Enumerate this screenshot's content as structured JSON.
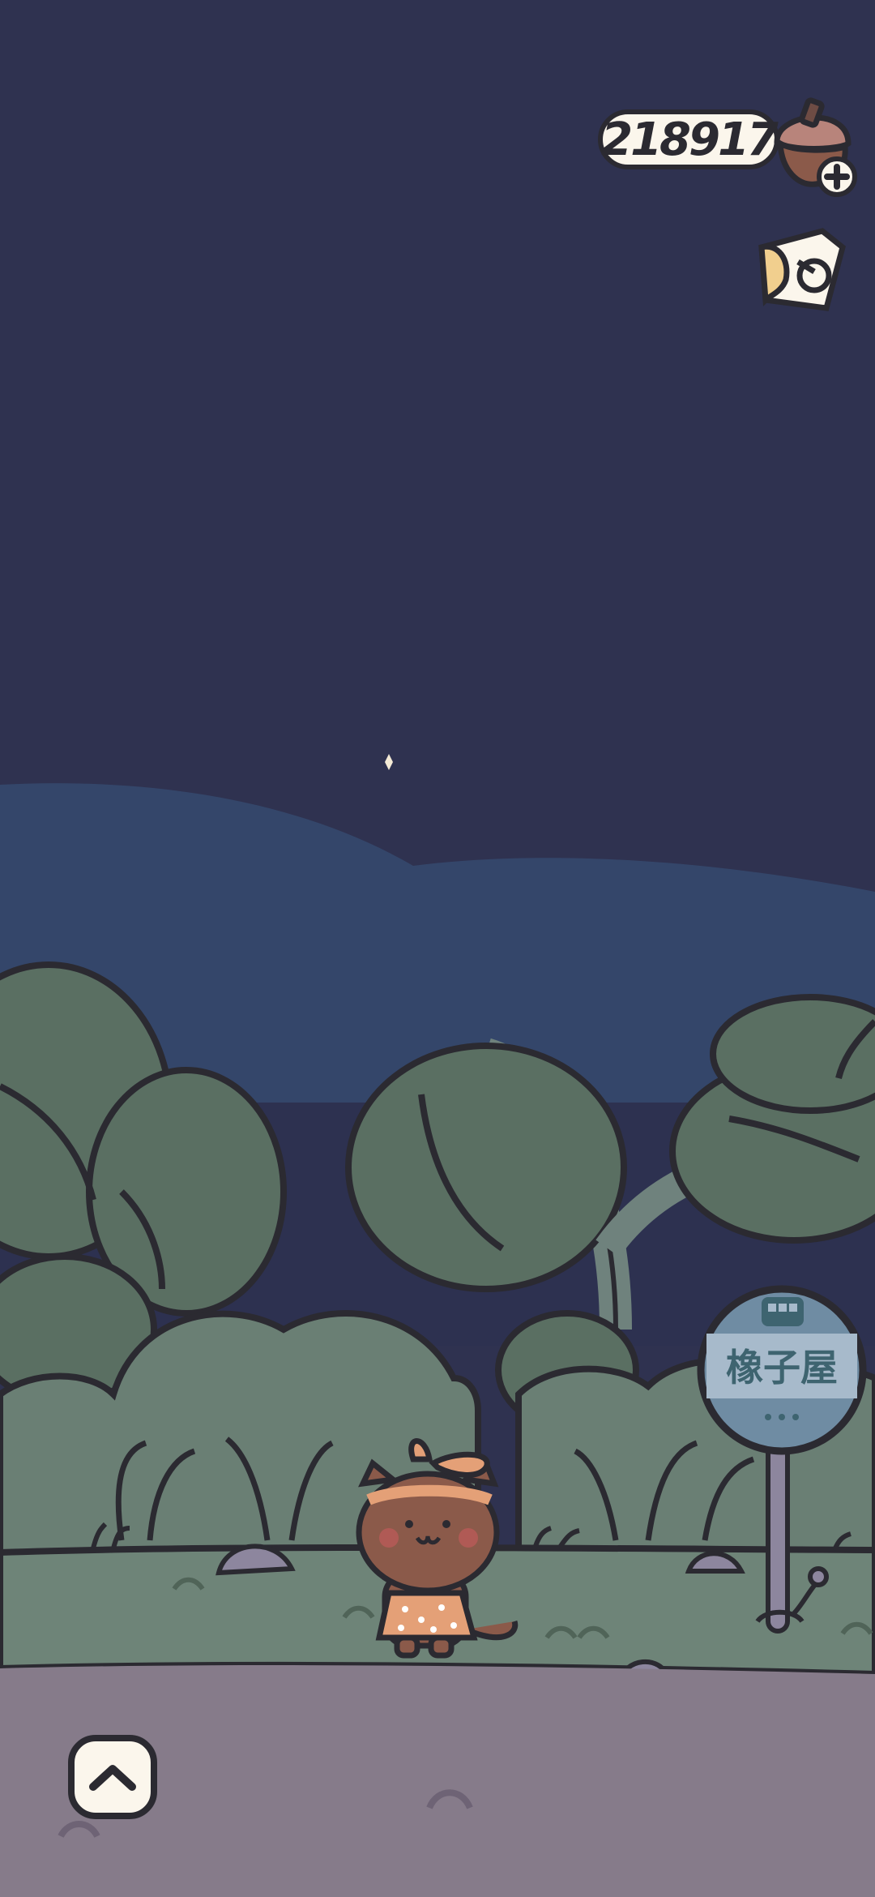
{
  "hud": {
    "currency_value": "218917",
    "currency_icon": "acorn-icon",
    "add_icon": "plus-icon",
    "ticket_icon": "ticket-icon"
  },
  "bus_stop": {
    "label": "橡子屋",
    "icon": "bus-icon"
  },
  "controls": {
    "expand_icon": "chevron-up-icon"
  },
  "colors": {
    "sky": "#2f3250",
    "hills": "#34466a",
    "foliage": "#5a6f62",
    "grass": "#6e8478",
    "ground": "#867b8a",
    "outline": "#2b2a31",
    "cat_fur": "#8b5a4a",
    "bow": "#e4a077"
  }
}
